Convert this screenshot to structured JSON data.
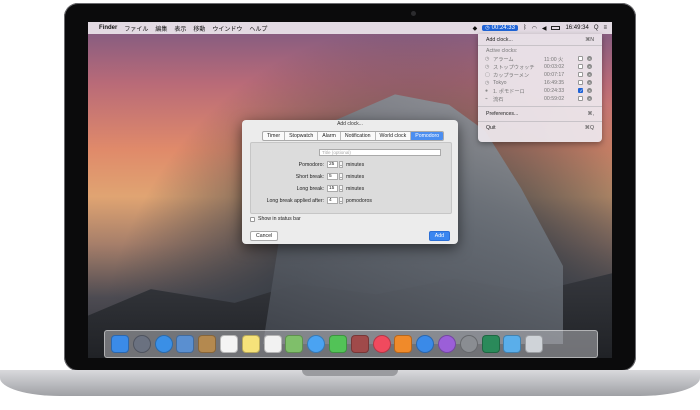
{
  "menubar": {
    "app_name": "Finder",
    "items": [
      "ファイル",
      "編集",
      "表示",
      "移動",
      "ウインドウ",
      "ヘルプ"
    ],
    "clock_display": "00:24:33",
    "time": "16:49:34",
    "search_glyph": "Q",
    "menu_glyph": "≡"
  },
  "dropdown": {
    "add_label": "Add clock...",
    "add_shortcut": "⌘N",
    "header": "Active clocks:",
    "clocks": [
      {
        "name": "アラーム",
        "time": "11:00 火",
        "checked": false
      },
      {
        "name": "ストップウォッチ",
        "time": "00:03:02",
        "checked": false
      },
      {
        "name": "カップラーメン",
        "time": "00:07:17",
        "checked": false
      },
      {
        "name": "Tokyo",
        "time": "16:49:35",
        "checked": false
      },
      {
        "name": "1. ポモドーロ",
        "time": "00:24:33",
        "checked": true
      },
      {
        "name": "流石",
        "time": "00:59:02",
        "checked": false
      }
    ],
    "preferences_label": "Preferences...",
    "preferences_shortcut": "⌘,",
    "quit_label": "Quit",
    "quit_shortcut": "⌘Q"
  },
  "dialog": {
    "title": "Add clock...",
    "tabs": [
      "Timer",
      "Stopwatch",
      "Alarm",
      "Notification",
      "World clock",
      "Pomodoro"
    ],
    "active_tab": "Pomodoro",
    "title_placeholder": "Title (optional)",
    "fields": [
      {
        "label": "Pomodoro:",
        "value": "25",
        "unit": "minutes"
      },
      {
        "label": "Short break:",
        "value": "5",
        "unit": "minutes"
      },
      {
        "label": "Long break:",
        "value": "15",
        "unit": "minutes"
      },
      {
        "label": "Long break applied after:",
        "value": "4",
        "unit": "pomodoros"
      }
    ],
    "show_in_status_bar": "Show in status bar",
    "show_in_status_bar_checked": false,
    "cancel_label": "Cancel",
    "add_label": "Add"
  },
  "dock": {
    "icons": [
      {
        "name": "finder-icon",
        "color": "#3b8be8"
      },
      {
        "name": "launchpad-icon",
        "color": "#6a7180"
      },
      {
        "name": "safari-icon",
        "color": "#3a8fe6"
      },
      {
        "name": "mail-icon",
        "color": "#5a8fd0"
      },
      {
        "name": "contacts-icon",
        "color": "#b4894f"
      },
      {
        "name": "calendar-icon",
        "color": "#f4f4f4"
      },
      {
        "name": "notes-icon",
        "color": "#f6e27a"
      },
      {
        "name": "reminders-icon",
        "color": "#f2f2f2"
      },
      {
        "name": "maps-icon",
        "color": "#7fbf6a"
      },
      {
        "name": "messages-icon",
        "color": "#4aa3f2"
      },
      {
        "name": "facetime-icon",
        "color": "#52c357"
      },
      {
        "name": "photo-booth-icon",
        "color": "#a04a4a"
      },
      {
        "name": "itunes-icon",
        "color": "#f04a5e"
      },
      {
        "name": "ibooks-icon",
        "color": "#f08a2a"
      },
      {
        "name": "app-store-icon",
        "color": "#3a8ae8"
      },
      {
        "name": "pomodoro-app-icon",
        "color": "#9b5fd8"
      },
      {
        "name": "system-preferences-icon",
        "color": "#8a8d92"
      },
      {
        "name": "screen-icon",
        "color": "#2a8a5a"
      },
      {
        "name": "downloads-folder-icon",
        "color": "#5aaeea"
      },
      {
        "name": "trash-icon",
        "color": "#cfd3d8"
      }
    ]
  }
}
